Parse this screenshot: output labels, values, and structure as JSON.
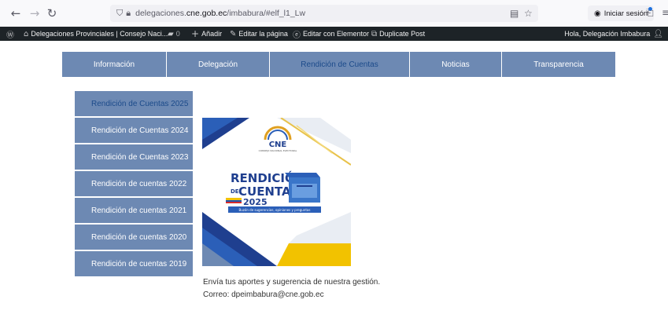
{
  "browser": {
    "url_prefix": "delegaciones.",
    "url_domain": "cne.gob.ec",
    "url_path": "/imbabura/#elf_l1_Lw",
    "signin_label": "Iniciar sesión"
  },
  "admin_bar": {
    "site_name": "Delegaciones Provinciales | Consejo Naci...",
    "comments_count": "0",
    "add_label": "Añadir",
    "edit_page_label": "Editar la página",
    "elementor_label": "Editar con Elementor",
    "duplicate_label": "Duplicate Post",
    "greeting": "Hola, Delegación Imbabura"
  },
  "main_nav": {
    "items": [
      {
        "label": "Información"
      },
      {
        "label": "Delegación"
      },
      {
        "label": "Rendición de Cuentas"
      },
      {
        "label": "Noticias"
      },
      {
        "label": "Transparencia"
      }
    ]
  },
  "side_menu": {
    "items": [
      {
        "label": "Rendición de Cuentas 2025"
      },
      {
        "label": "Rendición de Cuentas 2024"
      },
      {
        "label": "Rendición de Cuentas 2023"
      },
      {
        "label": "Rendición de cuentas 2022"
      },
      {
        "label": "Rendición de cuentas 2021"
      },
      {
        "label": "Rendición de cuentas 2020"
      },
      {
        "label": "Rendición de cuentas 2019"
      }
    ]
  },
  "banner": {
    "logo_text": "CNE",
    "logo_subtext": "CONSEJO NACIONAL ELECTORAL",
    "title_line1": "RENDICIÓN",
    "title_de": "DE",
    "title_line2": "CUENTAS",
    "year": "2025",
    "caption": "Buzón de sugerencias, opiniones y preguntas"
  },
  "content": {
    "line1": "Envía tus aportes y sugerencia de nuestra gestión.",
    "line2": "Correo: dpeimbabura@cne.gob.ec"
  },
  "colors": {
    "nav_bg": "#6d89b3",
    "active_text": "#1b4a8a",
    "admin_bg": "#1d2327"
  }
}
